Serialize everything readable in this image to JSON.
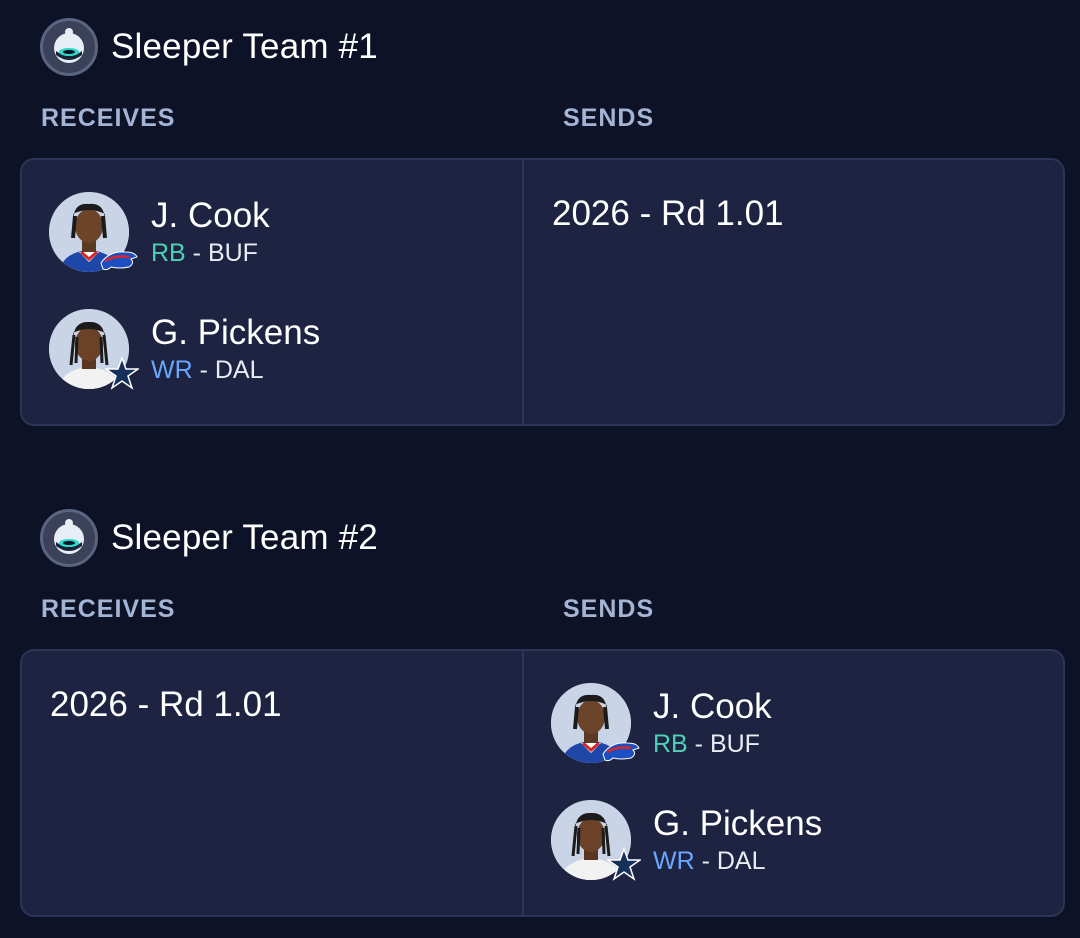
{
  "trades": [
    {
      "team_name": "Sleeper Team #1",
      "receives_label": "RECEIVES",
      "sends_label": "SENDS",
      "receives_players": [
        {
          "name": "J. Cook",
          "position": "RB",
          "separator": " - ",
          "team": "BUF",
          "logo": "bills-logo-icon"
        },
        {
          "name": "G. Pickens",
          "position": "WR",
          "separator": " - ",
          "team": "DAL",
          "logo": "cowboys-star-icon"
        }
      ],
      "sends_pick": "2026 - Rd 1.01"
    },
    {
      "team_name": "Sleeper Team #2",
      "receives_label": "RECEIVES",
      "sends_label": "SENDS",
      "receives_pick": "2026 - Rd 1.01",
      "sends_players": [
        {
          "name": "J. Cook",
          "position": "RB",
          "separator": " - ",
          "team": "BUF",
          "logo": "bills-logo-icon"
        },
        {
          "name": "G. Pickens",
          "position": "WR",
          "separator": " - ",
          "team": "DAL",
          "logo": "cowboys-star-icon"
        }
      ]
    }
  ],
  "colors": {
    "background": "#0d1226",
    "card": "#1d2340",
    "card_border": "#2c3556",
    "label": "#a3b4d4",
    "rb": "#4fd1b4",
    "wr": "#6aa8ff"
  }
}
